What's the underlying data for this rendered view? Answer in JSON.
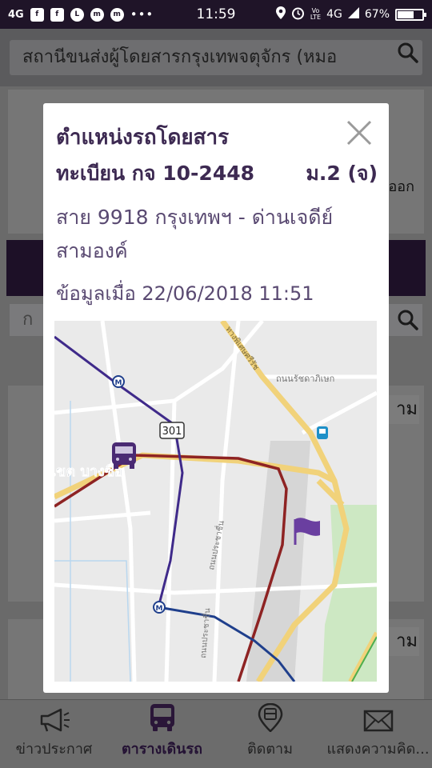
{
  "status_bar": {
    "network": "4G",
    "time": "11:59",
    "lte_label": "4G",
    "battery": "67%",
    "battery_level": 0.67,
    "icons": [
      "facebook-icon",
      "facebook-icon",
      "line-icon",
      "messenger-icon",
      "messenger-icon",
      "more-dots-icon",
      "location-icon",
      "alarm-icon",
      "volte-icon",
      "signal-icon"
    ]
  },
  "background": {
    "search_text": "สถานีขนส่งผู้โดยสารกรุงเทพจตุจักร (หมอ",
    "side_text": "ออก",
    "filter_text": "ก",
    "buttons": [
      "าม",
      "าม"
    ]
  },
  "modal": {
    "title": "ตำแหน่งรถโดยสาร",
    "plate": "ทะเบียน กจ 10-2448",
    "route_code": "ม.2 (จ)",
    "route_line1": "สาย 9918 กรุงเทพฯ - ด่านเจดีย์",
    "route_line2": "สามองค์",
    "updated": "ข้อมูลเมื่อ 22/06/2018 11:51"
  },
  "map": {
    "road_badge": "301",
    "district_label": "เขต บางซื่อ",
    "street_labels": [
      "ทางพิเศษศรีรัช",
      "ถนนรัชดาภิเษก",
      "ถนนประชาชื่น",
      "ถนนประชาชื่น"
    ],
    "bus_icon": "bus-icon",
    "flag_icon": "flag-icon",
    "metro_icon": "metro-icon",
    "colors": {
      "route_purple": "#3f2a8a",
      "route_red": "#8e2323",
      "route_blue": "#1f3f8c",
      "expressway": "#f3d97c",
      "park": "#cde8c3",
      "flag": "#6a3fa0",
      "bus": "#4a2a73"
    }
  },
  "bottom_nav": [
    {
      "label": "ข่าวประกาศ",
      "icon": "megaphone-icon"
    },
    {
      "label": "ตารางเดินรถ",
      "icon": "bus-icon"
    },
    {
      "label": "ติดตาม",
      "icon": "bus-track-icon"
    },
    {
      "label": "แสดงความคิด...",
      "icon": "mail-icon"
    }
  ]
}
